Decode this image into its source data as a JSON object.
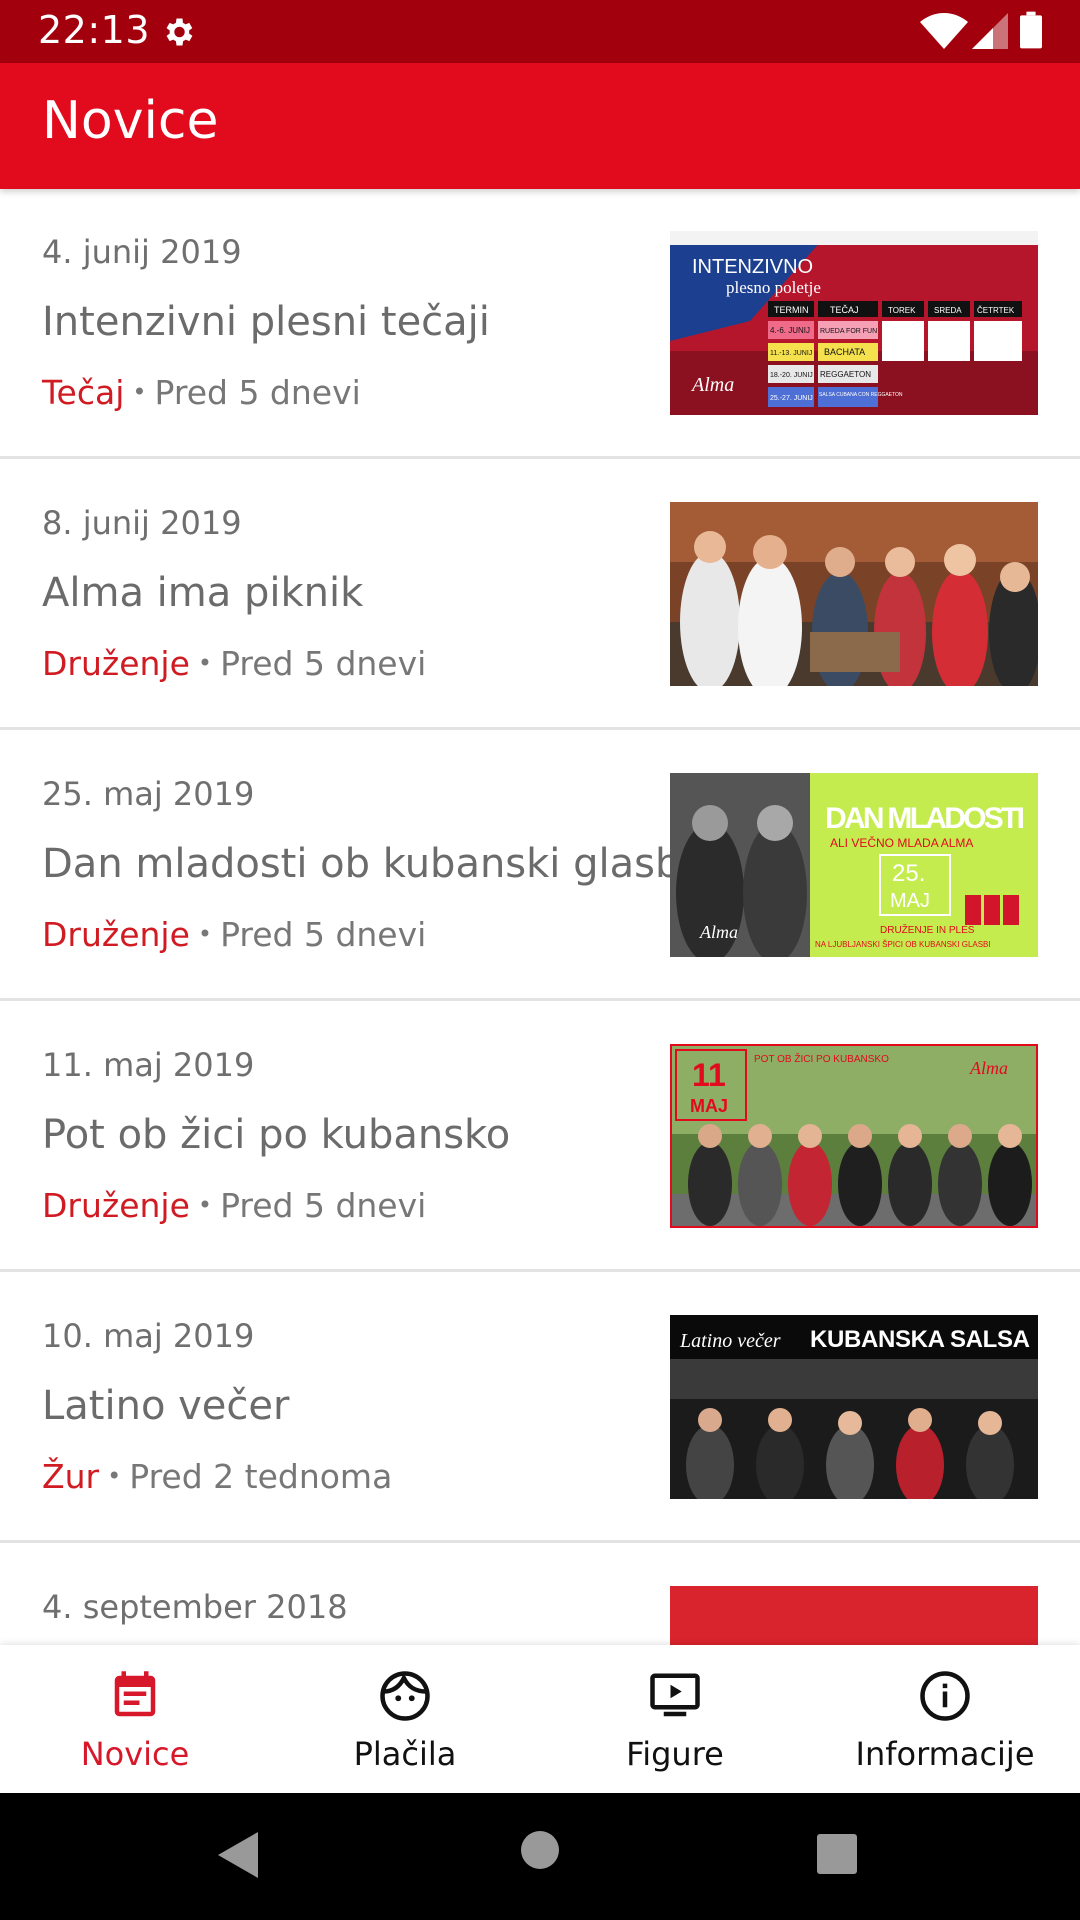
{
  "status_bar": {
    "time": "22:13",
    "icons": [
      "gear-icon",
      "wifi-icon",
      "signal-icon",
      "battery-icon"
    ]
  },
  "app_bar": {
    "title": "Novice"
  },
  "news": [
    {
      "date": "4. junij 2019",
      "title": "Intenzivni plesni tečaji",
      "category": "Tečaj",
      "age": "Pred 5 dnevi",
      "thumb_text": [
        "INTENZIVNO",
        "plesno poletje",
        "TERMIN",
        "TEČAJ",
        "TOREK",
        "SREDA",
        "ČETRTEK",
        "4.-6. JUNIJ",
        "RUEDA FOR FUN",
        "11.-13. JUNIJ",
        "BACHATA",
        "18.-20. JUNIJ",
        "REGGAETON",
        "25.-27. JUNIJ",
        "SALSA CUBANA CON REGGAETON",
        "Alma"
      ]
    },
    {
      "date": "8. junij 2019",
      "title": "Alma ima piknik",
      "category": "Druženje",
      "age": "Pred 5 dnevi",
      "thumb_text": []
    },
    {
      "date": "25. maj 2019",
      "title": "Dan mladosti ob kubanski glasbi",
      "category": "Druženje",
      "age": "Pred 5 dnevi",
      "thumb_text": [
        "DAN MLADOSTI",
        "ALI VEČNO MLADA ALMA",
        "25.",
        "MAJ",
        "DRUŽENJE IN PLES",
        "NA LJUBLJANSKI ŠPICI OB KUBANSKI GLASBI",
        "Alma"
      ]
    },
    {
      "date": "11. maj 2019",
      "title": "Pot ob žici po kubansko",
      "category": "Druženje",
      "age": "Pred 5 dnevi",
      "thumb_text": [
        "11",
        "MAJ",
        "POT OB ŽICI PO KUBANSKO",
        "Alma"
      ]
    },
    {
      "date": "10. maj 2019",
      "title": "Latino večer",
      "category": "Žur",
      "age": "Pred 2 tednoma",
      "thumb_text": [
        "Latino večer",
        "KUBANSKA SALSA"
      ]
    },
    {
      "date": "4. september 2018",
      "title": "",
      "category": "",
      "age": "",
      "thumb_text": []
    }
  ],
  "bottom_nav": [
    {
      "label": "Novice",
      "icon": "calendar-icon",
      "active": true
    },
    {
      "label": "Plačila",
      "icon": "face-icon",
      "active": false
    },
    {
      "label": "Figure",
      "icon": "video-icon",
      "active": false
    },
    {
      "label": "Informacije",
      "icon": "info-icon",
      "active": false
    }
  ],
  "system_nav": [
    "back-icon",
    "home-icon",
    "recents-icon"
  ],
  "colors": {
    "primary": "#e20a1d",
    "status_bar": "#a3000d",
    "accent_text": "#d11b23"
  }
}
